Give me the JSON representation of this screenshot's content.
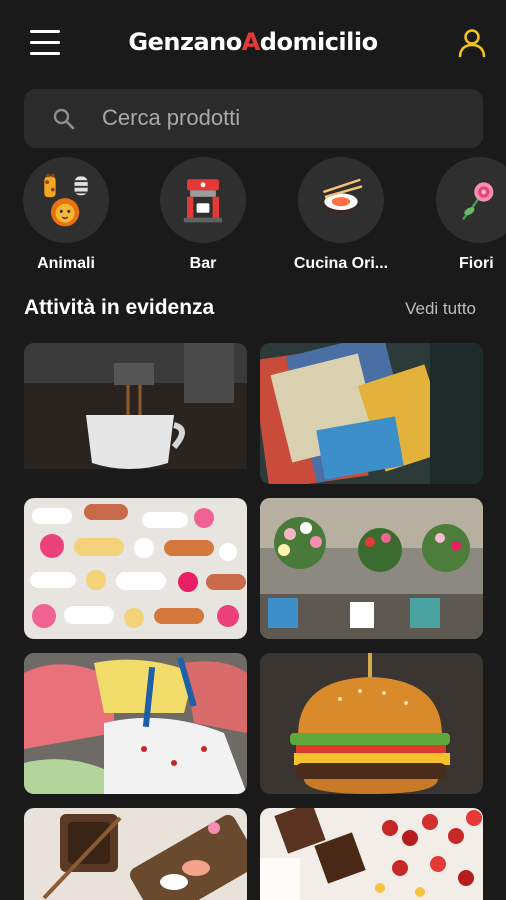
{
  "app": {
    "logo_part1": "Genzano",
    "logo_accent": "A",
    "logo_part2": "domicilio"
  },
  "search": {
    "placeholder": "Cerca prodotti"
  },
  "categories": [
    {
      "label": "Animali",
      "icon": "animals-icon"
    },
    {
      "label": "Bar",
      "icon": "coffee-machine-icon"
    },
    {
      "label": "Cucina Ori...",
      "icon": "sushi-icon"
    },
    {
      "label": "Fiori",
      "icon": "flower-icon"
    }
  ],
  "featured": {
    "title": "Attività in evidenza",
    "see_all": "Vedi tutto",
    "items": [
      {
        "image": "espresso-photo"
      },
      {
        "image": "comics-photo"
      },
      {
        "image": "pills-photo"
      },
      {
        "image": "flowers-shop-photo"
      },
      {
        "image": "gelato-photo"
      },
      {
        "image": "burger-photo"
      },
      {
        "image": "sushi-plate-photo"
      },
      {
        "image": "pastries-photo"
      }
    ]
  },
  "colors": {
    "background": "#1a1a1a",
    "search_bg": "#2b2b2b",
    "accent_red": "#e53935",
    "user_icon": "#f5c518"
  }
}
